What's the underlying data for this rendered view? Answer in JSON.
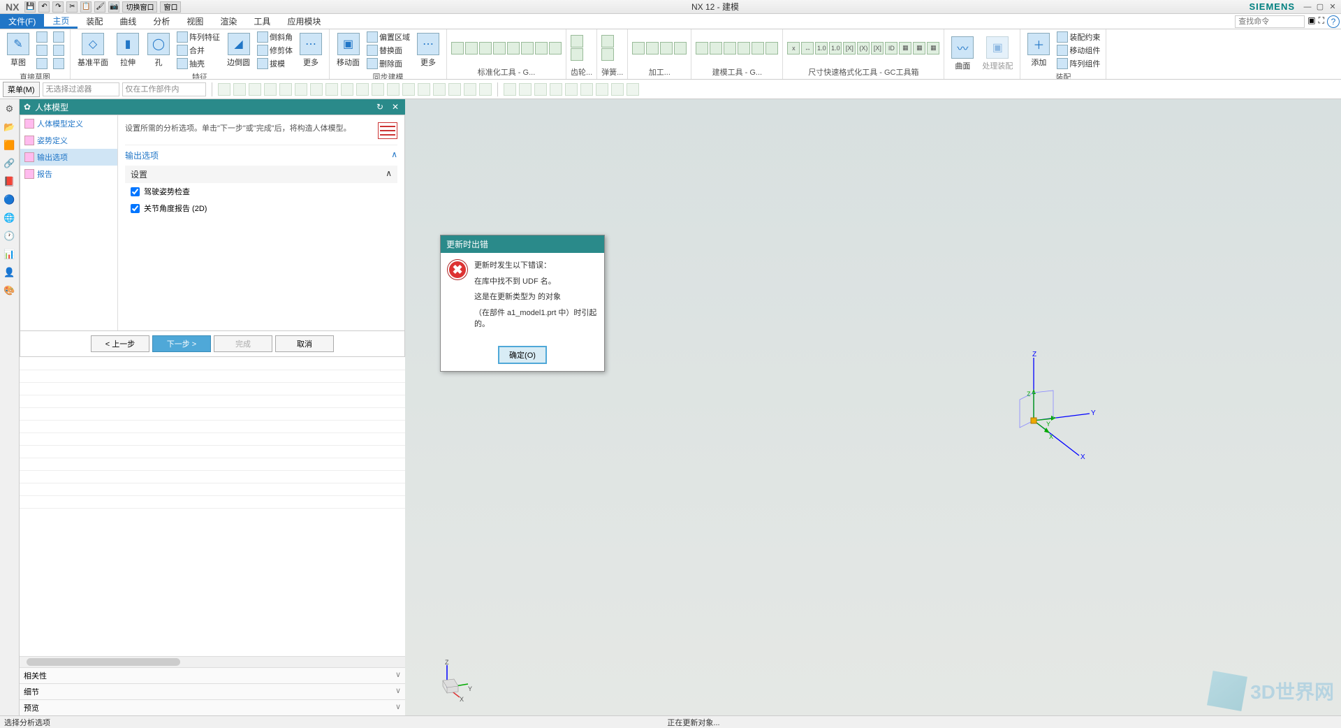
{
  "title": "NX 12 - 建模",
  "brand": "SIEMENS",
  "qat": {
    "switch_win": "切换窗口",
    "window": "窗口"
  },
  "menu": {
    "file": "文件(F)",
    "tabs": [
      "主页",
      "装配",
      "曲线",
      "分析",
      "视图",
      "渲染",
      "工具",
      "应用模块"
    ],
    "search_ph": "查找命令"
  },
  "ribbon": {
    "sketch": {
      "btn": "草图",
      "label": "直接草图"
    },
    "feature": {
      "datum": "基准平面",
      "extrude": "拉伸",
      "hole": "孔",
      "pattern": "阵列特征",
      "unite": "合并",
      "shell": "抽壳",
      "chamfer": "倒斜角",
      "trim": "修剪体",
      "draft": "拔模",
      "edge": "边倒圆",
      "more": "更多",
      "label": "特征"
    },
    "sync": {
      "moveface": "移动面",
      "oregion": "偏置区域",
      "rface": "替换面",
      "dface": "删除面",
      "more": "更多",
      "label": "同步建模"
    },
    "groups": {
      "std": "标准化工具 - G...",
      "gear": "齿轮...",
      "spring": "弹簧...",
      "proc": "加工...",
      "model": "建模工具 - G...",
      "dim": "尺寸快速格式化工具 - GC工具箱"
    },
    "surf": {
      "btn": "曲面",
      "proc": "处理装配"
    },
    "asm": {
      "add": "添加",
      "constraint": "装配约束",
      "movec": "移动组件",
      "patc": "阵列组件",
      "label": "装配"
    }
  },
  "filter": {
    "menu": "菜单(M)",
    "nofilter": "无选择过滤器",
    "inwork": "仅在工作部件内"
  },
  "panel": {
    "title": "人体模型",
    "nav": [
      "人体模型定义",
      "姿势定义",
      "输出选项",
      "报告"
    ],
    "desc": "设置所需的分析选项。单击\"下一步\"或\"完成\"后，将构造人体模型。",
    "sec1": "输出选项",
    "sec2": "设置",
    "chk1": "驾驶姿势检查",
    "chk2": "关节角度报告 (2D)",
    "btn_prev": "< 上一步",
    "btn_next": "下一步 >",
    "btn_finish": "完成",
    "btn_cancel": "取消"
  },
  "lower": {
    "related": "相关性",
    "detail": "细节",
    "preview": "预览"
  },
  "error": {
    "title": "更新时出错",
    "l1": "更新时发生以下错误：",
    "l2": "在库中找不到 UDF 名。",
    "l3": "这是在更新类型为  的对象",
    "l4": "（在部件 a1_model1.prt 中）时引起的。",
    "ok": "确定(O)"
  },
  "status": {
    "left": "选择分析选项",
    "center": "正在更新对象..."
  },
  "watermark": "3D世界网"
}
